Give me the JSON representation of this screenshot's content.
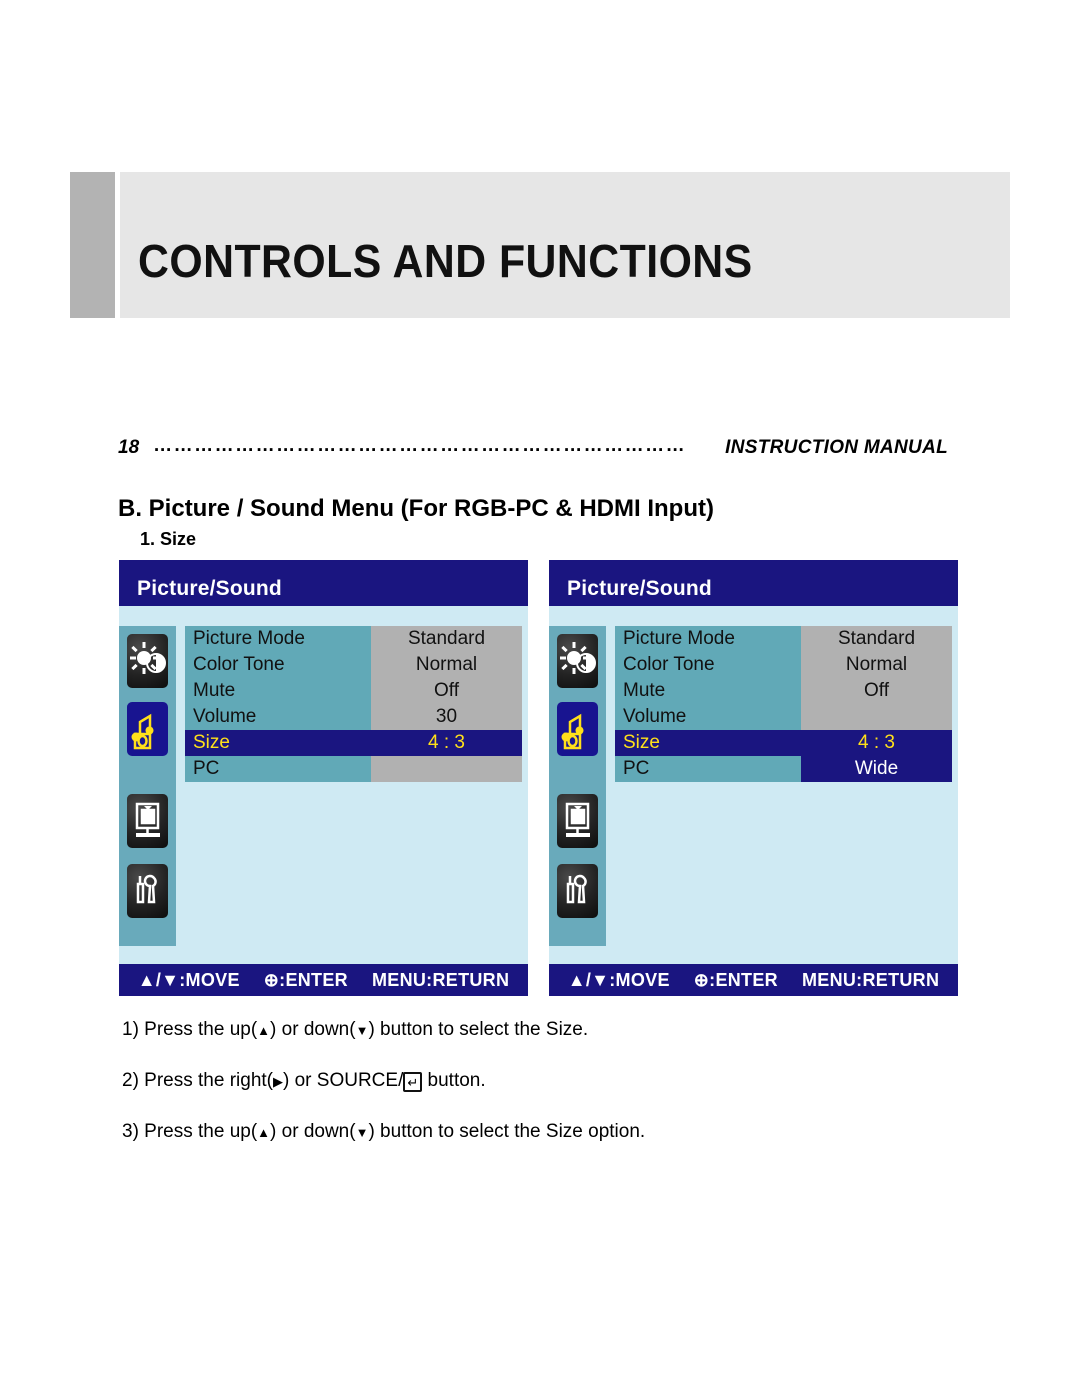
{
  "chapter": {
    "title": "CONTROLS AND FUNCTIONS"
  },
  "running_head": {
    "page_number": "18",
    "leader": "……………………………………………………………………",
    "manual_label": "INSTRUCTION MANUAL"
  },
  "headings": {
    "section": "B. Picture / Sound Menu (For RGB-PC & HDMI Input)",
    "subsection": "1. Size"
  },
  "osd": {
    "title": "Picture/Sound",
    "icons": [
      {
        "name": "brightness-contrast-icon",
        "selected": false
      },
      {
        "name": "audio-sound-icon",
        "selected": true
      },
      {
        "name": "monitor-setup-icon",
        "selected": false
      },
      {
        "name": "tools-setup-icon",
        "selected": false
      }
    ],
    "footer": [
      "▲/▼:MOVE",
      "⊕:ENTER",
      "MENU:RETURN"
    ],
    "left_panel": {
      "rows": [
        {
          "label": "Picture Mode",
          "value": "Standard",
          "highlight": false
        },
        {
          "label": "Color Tone",
          "value": "Normal",
          "highlight": false
        },
        {
          "label": "Mute",
          "value": "Off",
          "highlight": false
        },
        {
          "label": "Volume",
          "value": "30",
          "highlight": false
        },
        {
          "label": "Size",
          "value": "4 : 3",
          "highlight": true
        },
        {
          "label": "PC",
          "value": "",
          "highlight": false
        }
      ]
    },
    "right_panel": {
      "rows": [
        {
          "label": "Picture Mode",
          "value": "Standard",
          "highlight": false
        },
        {
          "label": "Color Tone",
          "value": "Normal",
          "highlight": false
        },
        {
          "label": "Mute",
          "value": "Off",
          "highlight": false
        },
        {
          "label": "Volume",
          "value": "",
          "highlight": false
        },
        {
          "label": "Size",
          "value": "",
          "highlight": true
        },
        {
          "label": "PC",
          "value": "",
          "highlight": false
        }
      ],
      "dropdown": {
        "options": [
          {
            "label": "4 : 3",
            "selected": true
          },
          {
            "label": "Wide",
            "selected": false
          }
        ]
      }
    }
  },
  "instructions": [
    {
      "prefix": "1) Press the up(",
      "up": "▲",
      "mid": ") or down(",
      "down": "▼",
      "suffix": ") button to select the Size."
    },
    {
      "prefix": "2) Press the right(",
      "up": "▶",
      "mid": ") or SOURCE/",
      "down": "",
      "suffix": " button."
    },
    {
      "prefix": "3) Press the up(",
      "up": "▲",
      "mid": ") or down(",
      "down": "▼",
      "suffix": ") button to select the Size option."
    }
  ],
  "colors": {
    "osd_navy": "#1a1580",
    "osd_body": "#cfeaf3",
    "osd_label": "#61a9b7",
    "osd_value": "#b1b1b1",
    "highlight_text": "#ffe01a",
    "header_band": "#e6e6e6",
    "header_accent": "#b3b3b3"
  }
}
